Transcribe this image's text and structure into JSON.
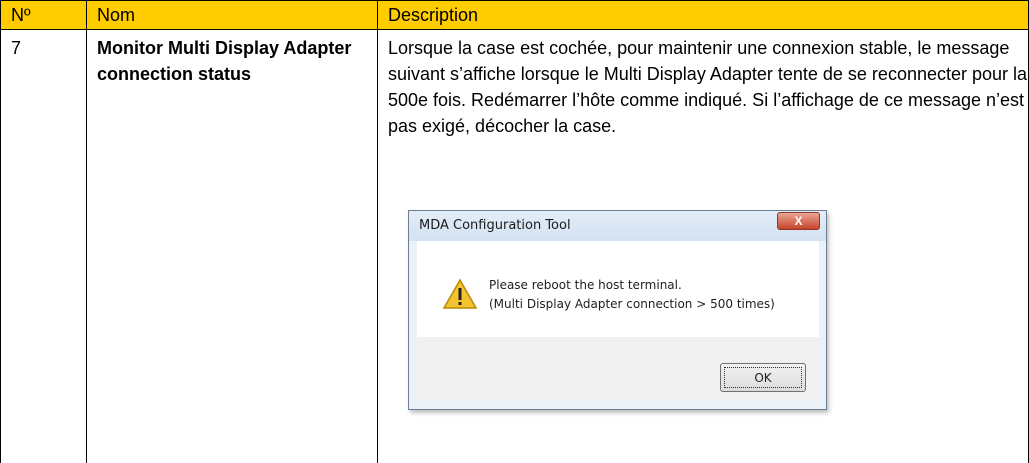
{
  "table": {
    "headers": {
      "no": "Nº",
      "nom": "Nom",
      "description": "Description"
    },
    "row": {
      "no": "7",
      "nom": "Monitor Multi Display Adapter connection status",
      "description": "Lorsque la case est cochée, pour maintenir une connexion stable, le message suivant s’affiche lorsque le Multi Display Adapter tente de se reconnecter pour la 500e fois. Redémarrer l’hôte comme indiqué. Si l’affichage de ce message n’est pas exigé, décocher la case."
    }
  },
  "dialog": {
    "title": "MDA Configuration Tool",
    "close_glyph": "X",
    "message_line1": "Please reboot the host terminal.",
    "message_line2": "(Multi Display Adapter connection > 500 times)",
    "ok_label": "OK",
    "icon": "warning-icon"
  },
  "colors": {
    "header_background": "#ffcc00"
  }
}
